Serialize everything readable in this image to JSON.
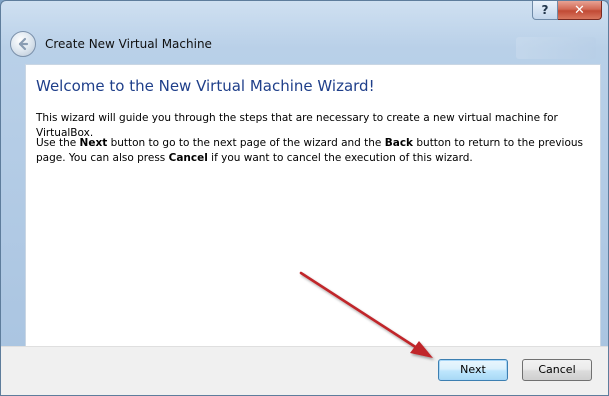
{
  "window": {
    "help_label": "?",
    "close_label": "✕"
  },
  "header": {
    "title": "Create New Virtual Machine",
    "back_icon": "back-arrow-icon"
  },
  "content": {
    "heading": "Welcome to the New Virtual Machine Wizard!",
    "para1": "This wizard will guide you through the steps that are necessary to create a new virtual machine for VirtualBox.",
    "para2_parts": {
      "p1": "Use the ",
      "b1": "Next",
      "p2": " button to go to the next page of the wizard and the ",
      "b2": "Back",
      "p3": " button to return to the previous page. You can also press ",
      "b3": "Cancel",
      "p4": " if you want to cancel the execution of this wizard."
    }
  },
  "footer": {
    "next_label": "Next",
    "cancel_label": "Cancel"
  },
  "colors": {
    "heading": "#1f3f8a",
    "annotation_arrow": "#c0262b"
  }
}
